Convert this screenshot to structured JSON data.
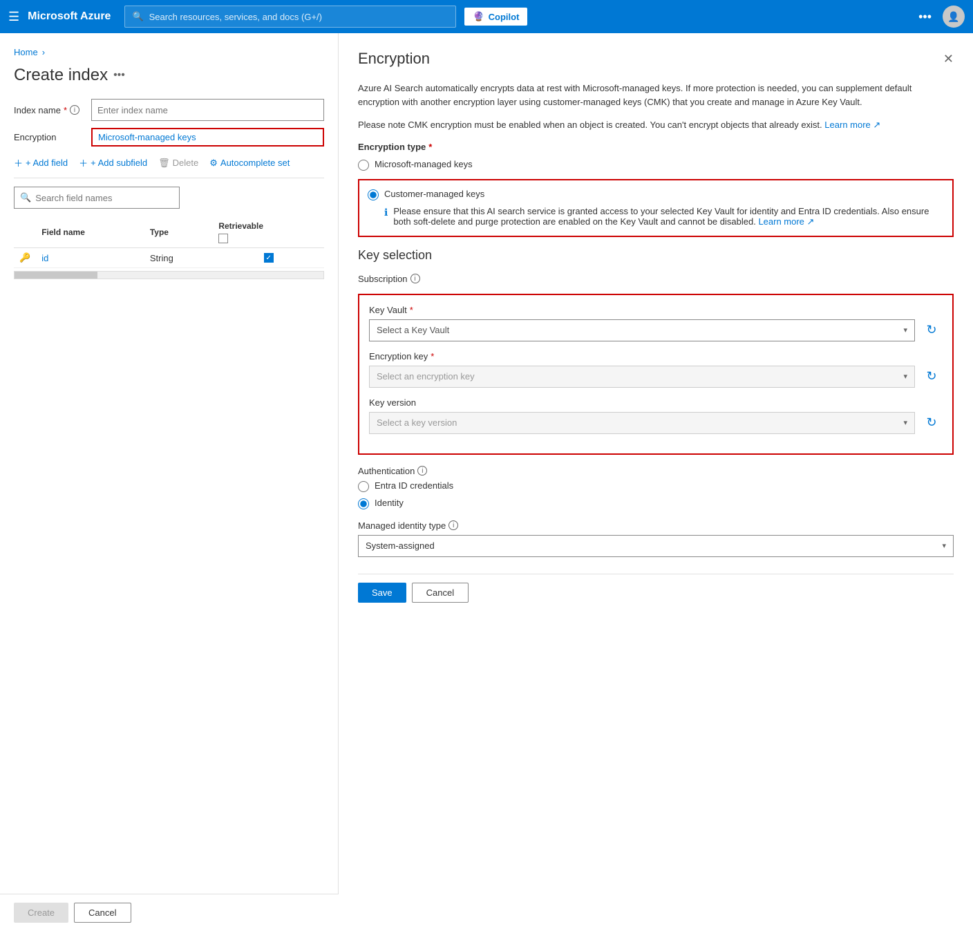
{
  "nav": {
    "hamburger": "☰",
    "brand": "Microsoft Azure",
    "search_placeholder": "Search resources, services, and docs (G+/)",
    "copilot_label": "Copilot",
    "copilot_icon": "🔮",
    "more_icon": "•••",
    "avatar_text": "👤"
  },
  "breadcrumb": {
    "home": "Home",
    "sep": "›"
  },
  "left": {
    "page_title": "Create index",
    "page_title_ellipsis": "•••",
    "index_name_label": "Index name",
    "index_name_required": "*",
    "index_name_info_icon": "ⓘ",
    "index_name_placeholder": "Enter index name",
    "encryption_label": "Encryption",
    "encryption_value": "Microsoft-managed keys",
    "toolbar": {
      "add_field": "+ Add field",
      "add_subfield": "+ Add subfield",
      "delete": "Delete",
      "autocomplete": "Autocomplete set"
    },
    "search_placeholder": "Search field names",
    "table": {
      "columns": [
        "Field name",
        "Type",
        "Retrievable"
      ],
      "rows": [
        {
          "icon": "🔑",
          "name": "id",
          "type": "String",
          "retrievable": true
        }
      ]
    },
    "buttons": {
      "create": "Create",
      "cancel": "Cancel"
    }
  },
  "right": {
    "title": "Encryption",
    "close_icon": "✕",
    "info_paragraph1": "Azure AI Search automatically encrypts data at rest with Microsoft-managed keys. If more protection is needed, you can supplement default encryption with another encryption layer using customer-managed keys (CMK) that you create and manage in Azure Key Vault.",
    "info_paragraph2": "Please note CMK encryption must be enabled when an object is created. You can't encrypt objects that already exist.",
    "learn_more": "Learn more",
    "learn_more_icon": "↗",
    "encryption_type_label": "Encryption type",
    "encryption_type_required": "*",
    "option_mmk": "Microsoft-managed keys",
    "option_cmk": "Customer-managed keys",
    "cmk_info": "Please ensure that this AI search service is granted access to your selected Key Vault for identity and Entra ID credentials. Also ensure both soft-delete and purge protection are enabled on the Key Vault and cannot be disabled.",
    "cmk_learn_more": "Learn more",
    "cmk_learn_more_icon": "↗",
    "key_selection_title": "Key selection",
    "subscription_label": "Subscription",
    "subscription_info": "ⓘ",
    "key_vault_label": "Key Vault",
    "key_vault_required": "*",
    "key_vault_placeholder": "Select a Key Vault",
    "encryption_key_label": "Encryption key",
    "encryption_key_required": "*",
    "encryption_key_placeholder": "Select an encryption key",
    "key_version_label": "Key version",
    "key_version_placeholder": "Select a key version",
    "authentication_label": "Authentication",
    "authentication_info": "ⓘ",
    "auth_entra": "Entra ID credentials",
    "auth_identity": "Identity",
    "managed_identity_label": "Managed identity type",
    "managed_identity_info": "ⓘ",
    "managed_identity_value": "System-assigned",
    "buttons": {
      "save": "Save",
      "cancel": "Cancel"
    }
  }
}
